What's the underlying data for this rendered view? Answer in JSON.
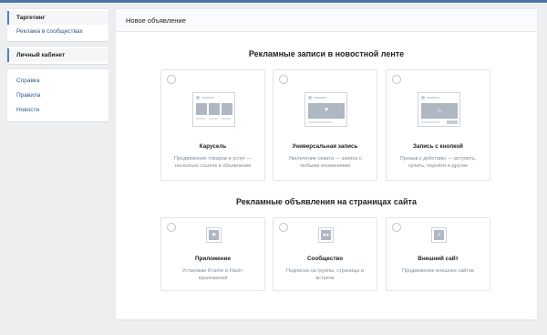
{
  "sidebar": {
    "group1": [
      {
        "label": "Таргетинг",
        "active": true
      },
      {
        "label": "Реклама в сообществах",
        "active": false
      }
    ],
    "group2": [
      {
        "label": "Личный кабинет",
        "active": true
      }
    ],
    "group3": [
      {
        "label": "Справка"
      },
      {
        "label": "Правила"
      },
      {
        "label": "Новости"
      }
    ]
  },
  "main": {
    "title": "Новое объявление",
    "section1": {
      "title": "Рекламные записи в новостной ленте",
      "cards": [
        {
          "label": "Карусель",
          "desc": "Продвижение товаров и услуг — несколько ссылок в объявлении",
          "icon": "carousel-icon"
        },
        {
          "label": "Универсальная запись",
          "desc": "Увеличение охвата — записи с любыми вложениями",
          "icon": "heart-post-icon"
        },
        {
          "label": "Запись с кнопкой",
          "desc": "Призыв к действию — вступить, купить, перейти и другие",
          "icon": "fire-post-icon"
        }
      ]
    },
    "section2": {
      "title": "Рекламные объявления на страницах сайта",
      "cards": [
        {
          "label": "Приложение",
          "desc": "Установки iFrame и Flash-приложений",
          "icon": "gamepad-icon"
        },
        {
          "label": "Сообщество",
          "desc": "Подписка на группы, страницы и встречи",
          "icon": "users-icon"
        },
        {
          "label": "Внешний сайт",
          "desc": "Продвижение внешних сайтов",
          "icon": "external-link-icon"
        }
      ]
    }
  },
  "colors": {
    "background": "#edeef0",
    "accent": "#5181b8",
    "link": "#2a5885",
    "muted": "#818c99",
    "illustration": "#aeb7c2"
  }
}
